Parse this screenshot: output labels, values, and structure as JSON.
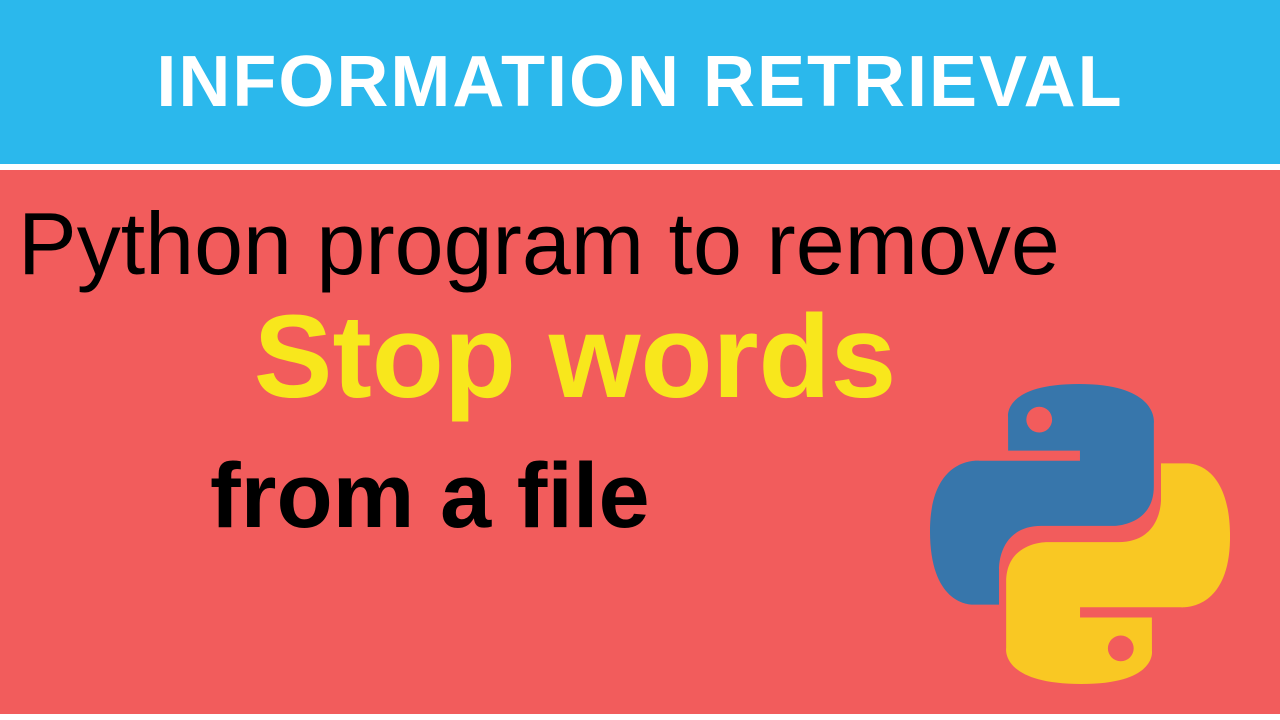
{
  "banner": {
    "title": "INFORMATION RETRIEVAL"
  },
  "content": {
    "line1": "Python program to remove",
    "line2": "Stop words",
    "line3": "from a file"
  },
  "icon": {
    "name": "python-logo"
  },
  "colors": {
    "topBg": "#2bb8ec",
    "bottomBg": "#f25c5c",
    "highlight": "#f8e71c",
    "pythonBlue": "#3776ab",
    "pythonYellow": "#f9c823"
  }
}
